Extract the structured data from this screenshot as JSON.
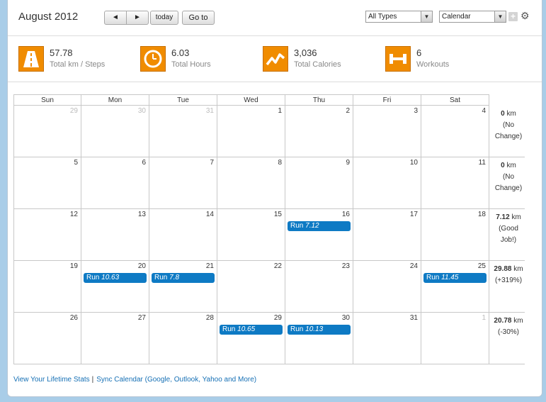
{
  "header": {
    "title": "August 2012",
    "prev_label": "◄",
    "next_label": "►",
    "today_label": "today",
    "goto_label": "Go to",
    "types_select": "All Types",
    "view_select": "Calendar"
  },
  "stats": [
    {
      "value": "57.78",
      "label": "Total km / Steps",
      "icon": "road-icon"
    },
    {
      "value": "6.03",
      "label": "Total Hours",
      "icon": "clock-icon"
    },
    {
      "value": "3,036",
      "label": "Total Calories",
      "icon": "trend-icon"
    },
    {
      "value": "6",
      "label": "Workouts",
      "icon": "dumbbell-icon"
    }
  ],
  "calendar": {
    "days_of_week": [
      "Sun",
      "Mon",
      "Tue",
      "Wed",
      "Thu",
      "Fri",
      "Sat"
    ],
    "weeks": [
      {
        "days": [
          {
            "n": "29",
            "other": true
          },
          {
            "n": "30",
            "other": true
          },
          {
            "n": "31",
            "other": true
          },
          {
            "n": "1"
          },
          {
            "n": "2"
          },
          {
            "n": "3"
          },
          {
            "n": "4"
          }
        ],
        "summary": {
          "value": "0",
          "unit": "km",
          "note": "(No Change)"
        }
      },
      {
        "days": [
          {
            "n": "5"
          },
          {
            "n": "6"
          },
          {
            "n": "7"
          },
          {
            "n": "8"
          },
          {
            "n": "9"
          },
          {
            "n": "10"
          },
          {
            "n": "11"
          }
        ],
        "summary": {
          "value": "0",
          "unit": "km",
          "note": "(No Change)"
        }
      },
      {
        "days": [
          {
            "n": "12"
          },
          {
            "n": "13"
          },
          {
            "n": "14"
          },
          {
            "n": "15"
          },
          {
            "n": "16",
            "event": {
              "label": "Run",
              "value": "7.12"
            }
          },
          {
            "n": "17"
          },
          {
            "n": "18"
          }
        ],
        "summary": {
          "value": "7.12",
          "unit": "km",
          "note": "(Good Job!)"
        }
      },
      {
        "days": [
          {
            "n": "19"
          },
          {
            "n": "20",
            "event": {
              "label": "Run",
              "value": "10.63"
            }
          },
          {
            "n": "21",
            "event": {
              "label": "Run",
              "value": "7.8"
            }
          },
          {
            "n": "22"
          },
          {
            "n": "23"
          },
          {
            "n": "24"
          },
          {
            "n": "25",
            "event": {
              "label": "Run",
              "value": "11.45"
            }
          }
        ],
        "summary": {
          "value": "29.88",
          "unit": "km",
          "note": "(+319%)"
        }
      },
      {
        "days": [
          {
            "n": "26"
          },
          {
            "n": "27"
          },
          {
            "n": "28"
          },
          {
            "n": "29",
            "event": {
              "label": "Run",
              "value": "10.65"
            }
          },
          {
            "n": "30",
            "event": {
              "label": "Run",
              "value": "10.13"
            }
          },
          {
            "n": "31"
          },
          {
            "n": "1",
            "other": true
          }
        ],
        "summary": {
          "value": "20.78",
          "unit": "km",
          "note": "(-30%)"
        }
      }
    ]
  },
  "footer": {
    "lifetime_link": "View Your Lifetime Stats",
    "separator": "|",
    "sync_link": "Sync Calendar (Google, Outlook, Yahoo and More)"
  },
  "colors": {
    "accent": "#f08c00",
    "event": "#0e7ac4",
    "link": "#1670b5"
  }
}
